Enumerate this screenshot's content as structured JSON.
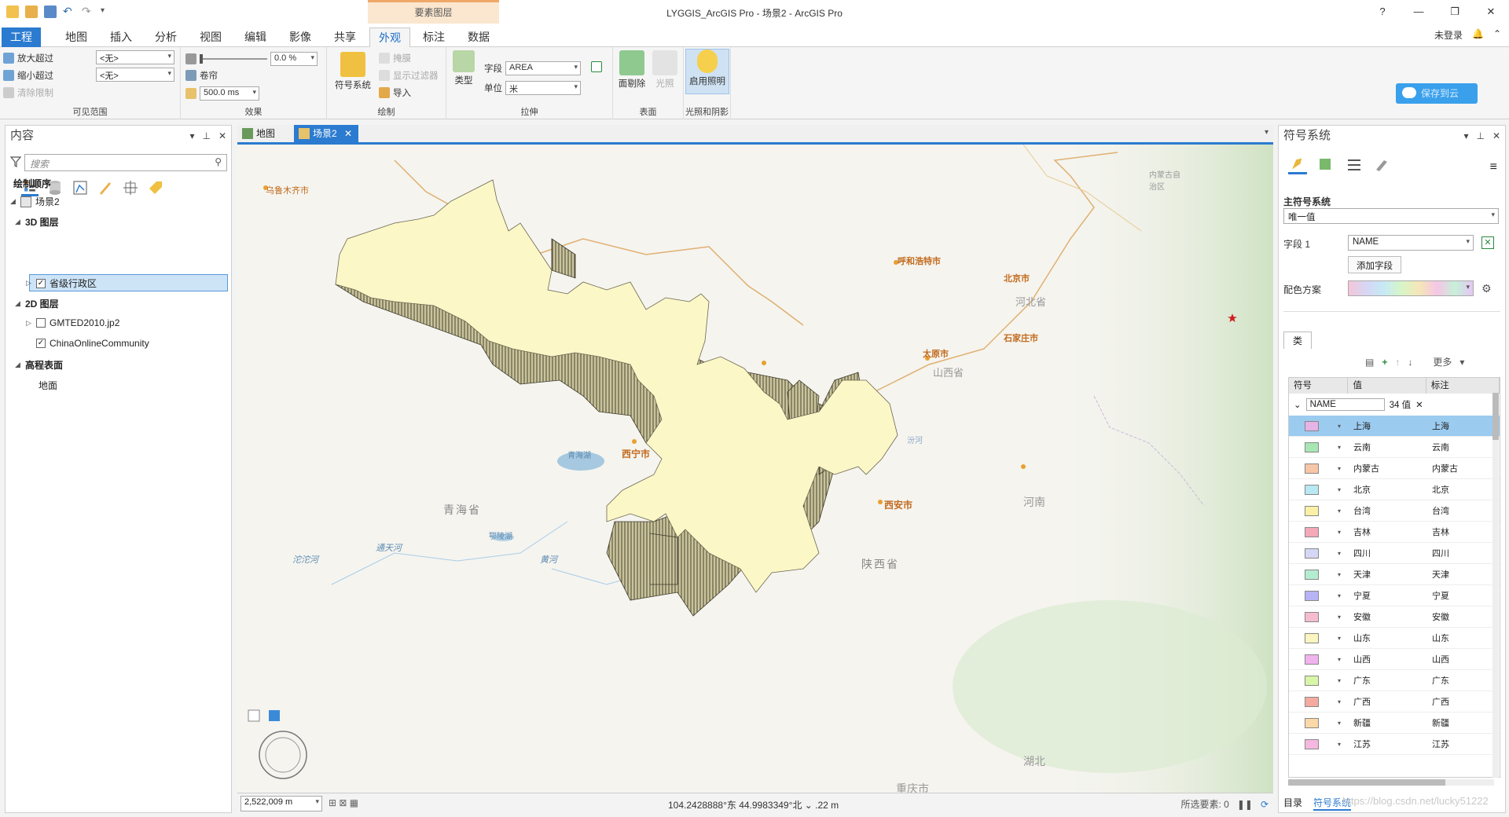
{
  "titlebar": {
    "context_group": "要素图层",
    "title": "LYGGIS_ArcGIS Pro - 场景2 - ArcGIS Pro",
    "help": "?",
    "minimize": "—",
    "restore": "❐",
    "close": "✕"
  },
  "tabs": [
    "工程",
    "地图",
    "插入",
    "分析",
    "视图",
    "编辑",
    "影像",
    "共享",
    "外观",
    "标注",
    "数据"
  ],
  "active_tab": "外观",
  "user": {
    "login": "未登录",
    "bell": "🔔",
    "pin": "⌃"
  },
  "cloud_button": "保存到云",
  "ribbon": {
    "visible_range": {
      "zoom_in_beyond": "放大超过",
      "zoom_out_beyond": "缩小超过",
      "clear_limit": "清除限制",
      "zoom_in_value": "<无>",
      "zoom_out_value": "<无>",
      "label": "可见范围"
    },
    "effects": {
      "transparency": "0.0",
      "transparency_unit": "%",
      "swipe": "卷帘",
      "flicker": "500.0",
      "flicker_unit": "ms",
      "label": "效果"
    },
    "drawing": {
      "symbology": "符号系统",
      "mask": "掩膜",
      "display_filter": "显示过滤器",
      "import": "导入",
      "label": "绘制"
    },
    "extrusion": {
      "type": "类型",
      "field_label": "字段",
      "field_value": "AREA",
      "unit_label": "单位",
      "unit_value": "米",
      "label": "拉伸"
    },
    "surface": {
      "face_culling": "面剔除",
      "light": "光照",
      "label": "表面"
    },
    "lighting": {
      "enable_lighting": "启用照明",
      "label": "光照和阴影"
    }
  },
  "contents": {
    "title": "内容",
    "search_placeholder": "搜索",
    "drawing_order": "绘制顺序",
    "scene": "场景2",
    "layers3d": "3D 图层",
    "layer_admin": "省级行政区",
    "layers2d": "2D 图层",
    "gmted": "GMTED2010.jp2",
    "basemap": "ChinaOnlineCommunity",
    "elevation": "高程表面",
    "ground": "地面"
  },
  "map_tabs": {
    "map": "地图",
    "scene": "场景2"
  },
  "map_labels": {
    "urumqi": "乌鲁木齐市",
    "inner_mongolia": "内蒙古自治区",
    "hohhot": "呼和浩特市",
    "beijing": "北京市",
    "hebei": "河北省",
    "shijiazhuang": "石家庄市",
    "taiyuan": "太原市",
    "shanxi": "山西省",
    "xining": "西宁市",
    "qinghai_lake": "青海湖",
    "qinghai": "青海省",
    "tuotuo": "沱沱河",
    "tongtian": "通天河",
    "eling": "鄂陵湖",
    "yellow_river": "黄河",
    "xian": "西安市",
    "shaanxi": "陕西省",
    "henan": "河南",
    "hubei": "湖北",
    "chongqing": "重庆市",
    "fenhe": "汾河"
  },
  "status": {
    "scale": "2,522,009 m",
    "coords": "104.2428888°东 44.9983349°北",
    "elev": ".22 m",
    "selected": "所选要素: 0"
  },
  "symbology": {
    "title": "符号系统",
    "primary": "主符号系统",
    "method": "唯一值",
    "field1_label": "字段 1",
    "field1_value": "NAME",
    "add_field": "添加字段",
    "color_scheme_label": "配色方案",
    "class_tab": "类",
    "more": "更多",
    "head_symbol": "符号",
    "head_value": "值",
    "head_label": "标注",
    "group_field": "NAME",
    "group_count": "34 值",
    "rows": [
      {
        "value": "上海",
        "label": "上海",
        "color": "#e6b3e6"
      },
      {
        "value": "云南",
        "label": "云南",
        "color": "#a8e6b3"
      },
      {
        "value": "内蒙古",
        "label": "内蒙古",
        "color": "#f7c6a8"
      },
      {
        "value": "北京",
        "label": "北京",
        "color": "#b8e8f2"
      },
      {
        "value": "台湾",
        "label": "台湾",
        "color": "#fbf0a6"
      },
      {
        "value": "吉林",
        "label": "吉林",
        "color": "#f5a8b8"
      },
      {
        "value": "四川",
        "label": "四川",
        "color": "#d6d6f5"
      },
      {
        "value": "天津",
        "label": "天津",
        "color": "#b3ecd0"
      },
      {
        "value": "宁夏",
        "label": "宁夏",
        "color": "#b8b3f5"
      },
      {
        "value": "安徽",
        "label": "安徽",
        "color": "#f5bcd0"
      },
      {
        "value": "山东",
        "label": "山东",
        "color": "#fbf5c0"
      },
      {
        "value": "山西",
        "label": "山西",
        "color": "#f0b3ee"
      },
      {
        "value": "广东",
        "label": "广东",
        "color": "#d8f5a8"
      },
      {
        "value": "广西",
        "label": "广西",
        "color": "#f5aaa0"
      },
      {
        "value": "新疆",
        "label": "新疆",
        "color": "#fbd8a8"
      },
      {
        "value": "江苏",
        "label": "江苏",
        "color": "#f5b8e0"
      }
    ],
    "bottom_tabs": [
      "目录",
      "符号系统"
    ],
    "watermark": "https://blog.csdn.net/lucky51222"
  }
}
